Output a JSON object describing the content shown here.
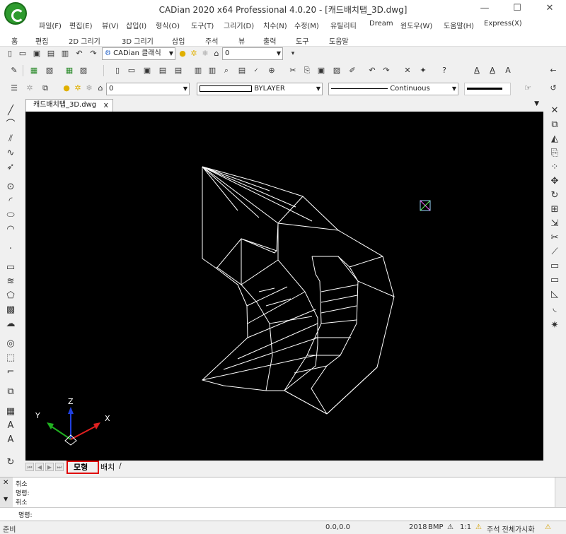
{
  "window": {
    "title": "CADian 2020 x64 Professional 4.0.20 - [캐드배치탭_3D.dwg]",
    "controls": {
      "minimize": "—",
      "maximize": "☐",
      "close": "✕"
    }
  },
  "menu": [
    "파일(F)",
    "편집(E)",
    "뷰(V)",
    "삽입(I)",
    "형식(O)",
    "도구(T)",
    "그리기(D)",
    "치수(N)",
    "수정(M)",
    "유틸리티",
    "Dream",
    "윈도우(W)",
    "도움말(H)",
    "Express(X)"
  ],
  "ribbon_tabs": [
    "홈",
    "편집",
    "2D 그리기",
    "3D 그리기",
    "삽입",
    "주석",
    "뷰",
    "출력",
    "도구",
    "도움말"
  ],
  "toolbar": {
    "workspace_value": "CADian 클래식",
    "layer_value_top": "0",
    "layer_value": "0",
    "color_value": "BYLAYER",
    "linetype_value": "Continuous"
  },
  "document_tab": {
    "label": "캐드배치탭_3D.dwg",
    "close": "x"
  },
  "ucs": {
    "x_label": "X",
    "y_label": "Y",
    "z_label": "Z"
  },
  "layout_tabs": {
    "model": "모형",
    "layout": "배치"
  },
  "command_history": [
    "취소",
    "명령:",
    "취소"
  ],
  "command_prompt": "명령:",
  "status": {
    "ready": "준비",
    "coords": "0.0,0.0",
    "year": "2018",
    "bmp": "BMP",
    "scale": "1:1",
    "annotation": "주석 전체가시화"
  },
  "colors": {
    "canvas": "#000000",
    "x_axis": "#e02020",
    "y_axis": "#20b020",
    "z_axis": "#2040e0",
    "model_tab_highlight": "#e00000"
  }
}
